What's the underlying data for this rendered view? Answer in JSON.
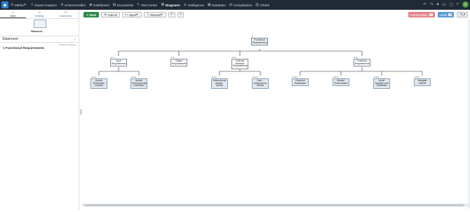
{
  "topbar": {
    "items": [
      {
        "label": "MENU",
        "icon": "menu-icon"
      },
      {
        "label": "Import Analyzer",
        "icon": "import-icon"
      },
      {
        "label": "Schema Editor",
        "icon": "schema-icon"
      },
      {
        "label": "Dashboard",
        "icon": "dashboard-icon"
      },
      {
        "label": "Documents",
        "icon": "documents-icon"
      },
      {
        "label": "Test Center",
        "icon": "test-icon"
      },
      {
        "label": "Diagrams",
        "icon": "diagrams-icon"
      },
      {
        "label": "Intelligence",
        "icon": "intelligence-icon"
      },
      {
        "label": "Database",
        "icon": "database-icon"
      },
      {
        "label": "Compilations",
        "icon": "compilations-icon"
      },
      {
        "label": "Charts",
        "icon": "charts-icon"
      }
    ],
    "active": "Diagrams",
    "avatar_initial": "S"
  },
  "sidebar": {
    "tabs": [
      {
        "label": "Main",
        "icon": "home-icon"
      },
      {
        "label": "Existing",
        "icon": "existing-icon"
      },
      {
        "label": "Comments",
        "icon": "comments-icon"
      }
    ],
    "thumbnail_label": "Statement",
    "section_title": "Statement",
    "sorted_label": "Sorted by Diagram",
    "item": "1 Functional Requirements"
  },
  "toolbar": {
    "save": "Save",
    "cancel": "Cancel",
    "open": "Open",
    "reports": "Reports",
    "compression_label": "Compression",
    "compression_count": "0",
    "level_label": "Level",
    "level_count": "5"
  },
  "diagram": {
    "nodes": [
      {
        "id": "root",
        "num": "1",
        "label": "Functional Requirements"
      },
      {
        "id": "n11",
        "num": "1.1",
        "label": "Input Requirements"
      },
      {
        "id": "n12",
        "num": "1.2",
        "label": "Output Requirements"
      },
      {
        "id": "n13",
        "num": "1.3",
        "label": "External Interface Requirements"
      },
      {
        "id": "n14",
        "num": "1.4",
        "label": "Functions Requirements"
      },
      {
        "id": "n111",
        "num": "1.1.1",
        "label": "Accept Destination Location"
      },
      {
        "id": "n112",
        "num": "1.1.2",
        "label": "Accept Environmental Conditions"
      },
      {
        "id": "n131",
        "num": "1.3.1",
        "label": "Autonomous vehicle - vehicle"
      },
      {
        "id": "n132",
        "num": "1.3.2",
        "label": "User - Autonomous vehicle"
      },
      {
        "id": "n141",
        "num": "1.4.1",
        "label": "Reached Destination"
      },
      {
        "id": "n142",
        "num": "1.4.2",
        "label": "Monitor Environment"
      },
      {
        "id": "n143",
        "num": "1.4.3",
        "label": "Avoid Accident and Obstacles"
      },
      {
        "id": "n144",
        "num": "1.4.4",
        "label": "Navigate Vehicle"
      }
    ]
  }
}
